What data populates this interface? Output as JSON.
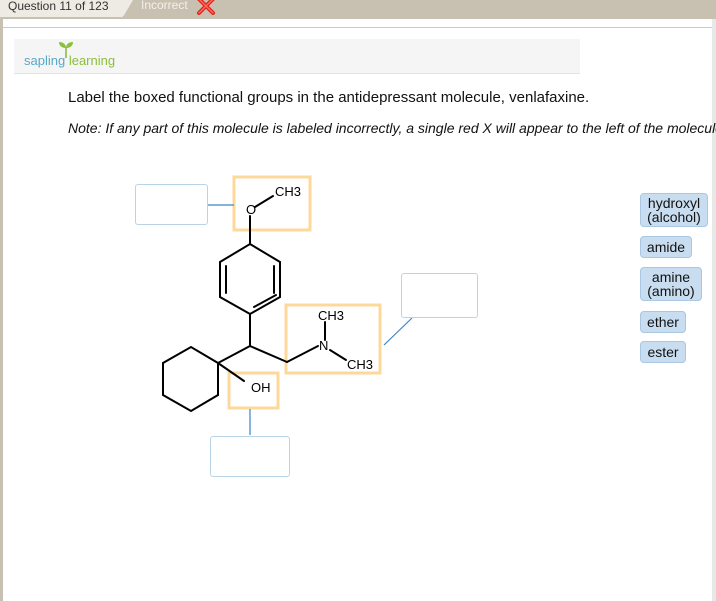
{
  "header": {
    "question_counter": "Question 11 of 123",
    "status": "Incorrect"
  },
  "logo": {
    "part1": "sapling",
    "part2": "learning"
  },
  "question": {
    "prompt": "Label the boxed functional groups in the antidepressant molecule, venlafaxine.",
    "note": "Note: If any part of this molecule is labeled incorrectly, a single red X will appear to the left of the molecule."
  },
  "molecule": {
    "methyl_top": "CH3",
    "oxygen": "O",
    "methyl_n1": "CH3",
    "nitrogen": "N",
    "methyl_n2": "CH3",
    "hydroxyl": "OH"
  },
  "labels": [
    {
      "id": "hydroxyl",
      "line1": "hydroxyl",
      "line2": "(alcohol)"
    },
    {
      "id": "amide",
      "line1": "amide",
      "line2": ""
    },
    {
      "id": "amine",
      "line1": "amine",
      "line2": "(amino)"
    },
    {
      "id": "ether",
      "line1": "ether",
      "line2": ""
    },
    {
      "id": "ester",
      "line1": "ester",
      "line2": ""
    }
  ],
  "colors": {
    "highlight_box": "#fcd89a",
    "connector": "#3a86c8",
    "label_bg": "#c9ddf0",
    "incorrect_x": "#e0201c"
  }
}
